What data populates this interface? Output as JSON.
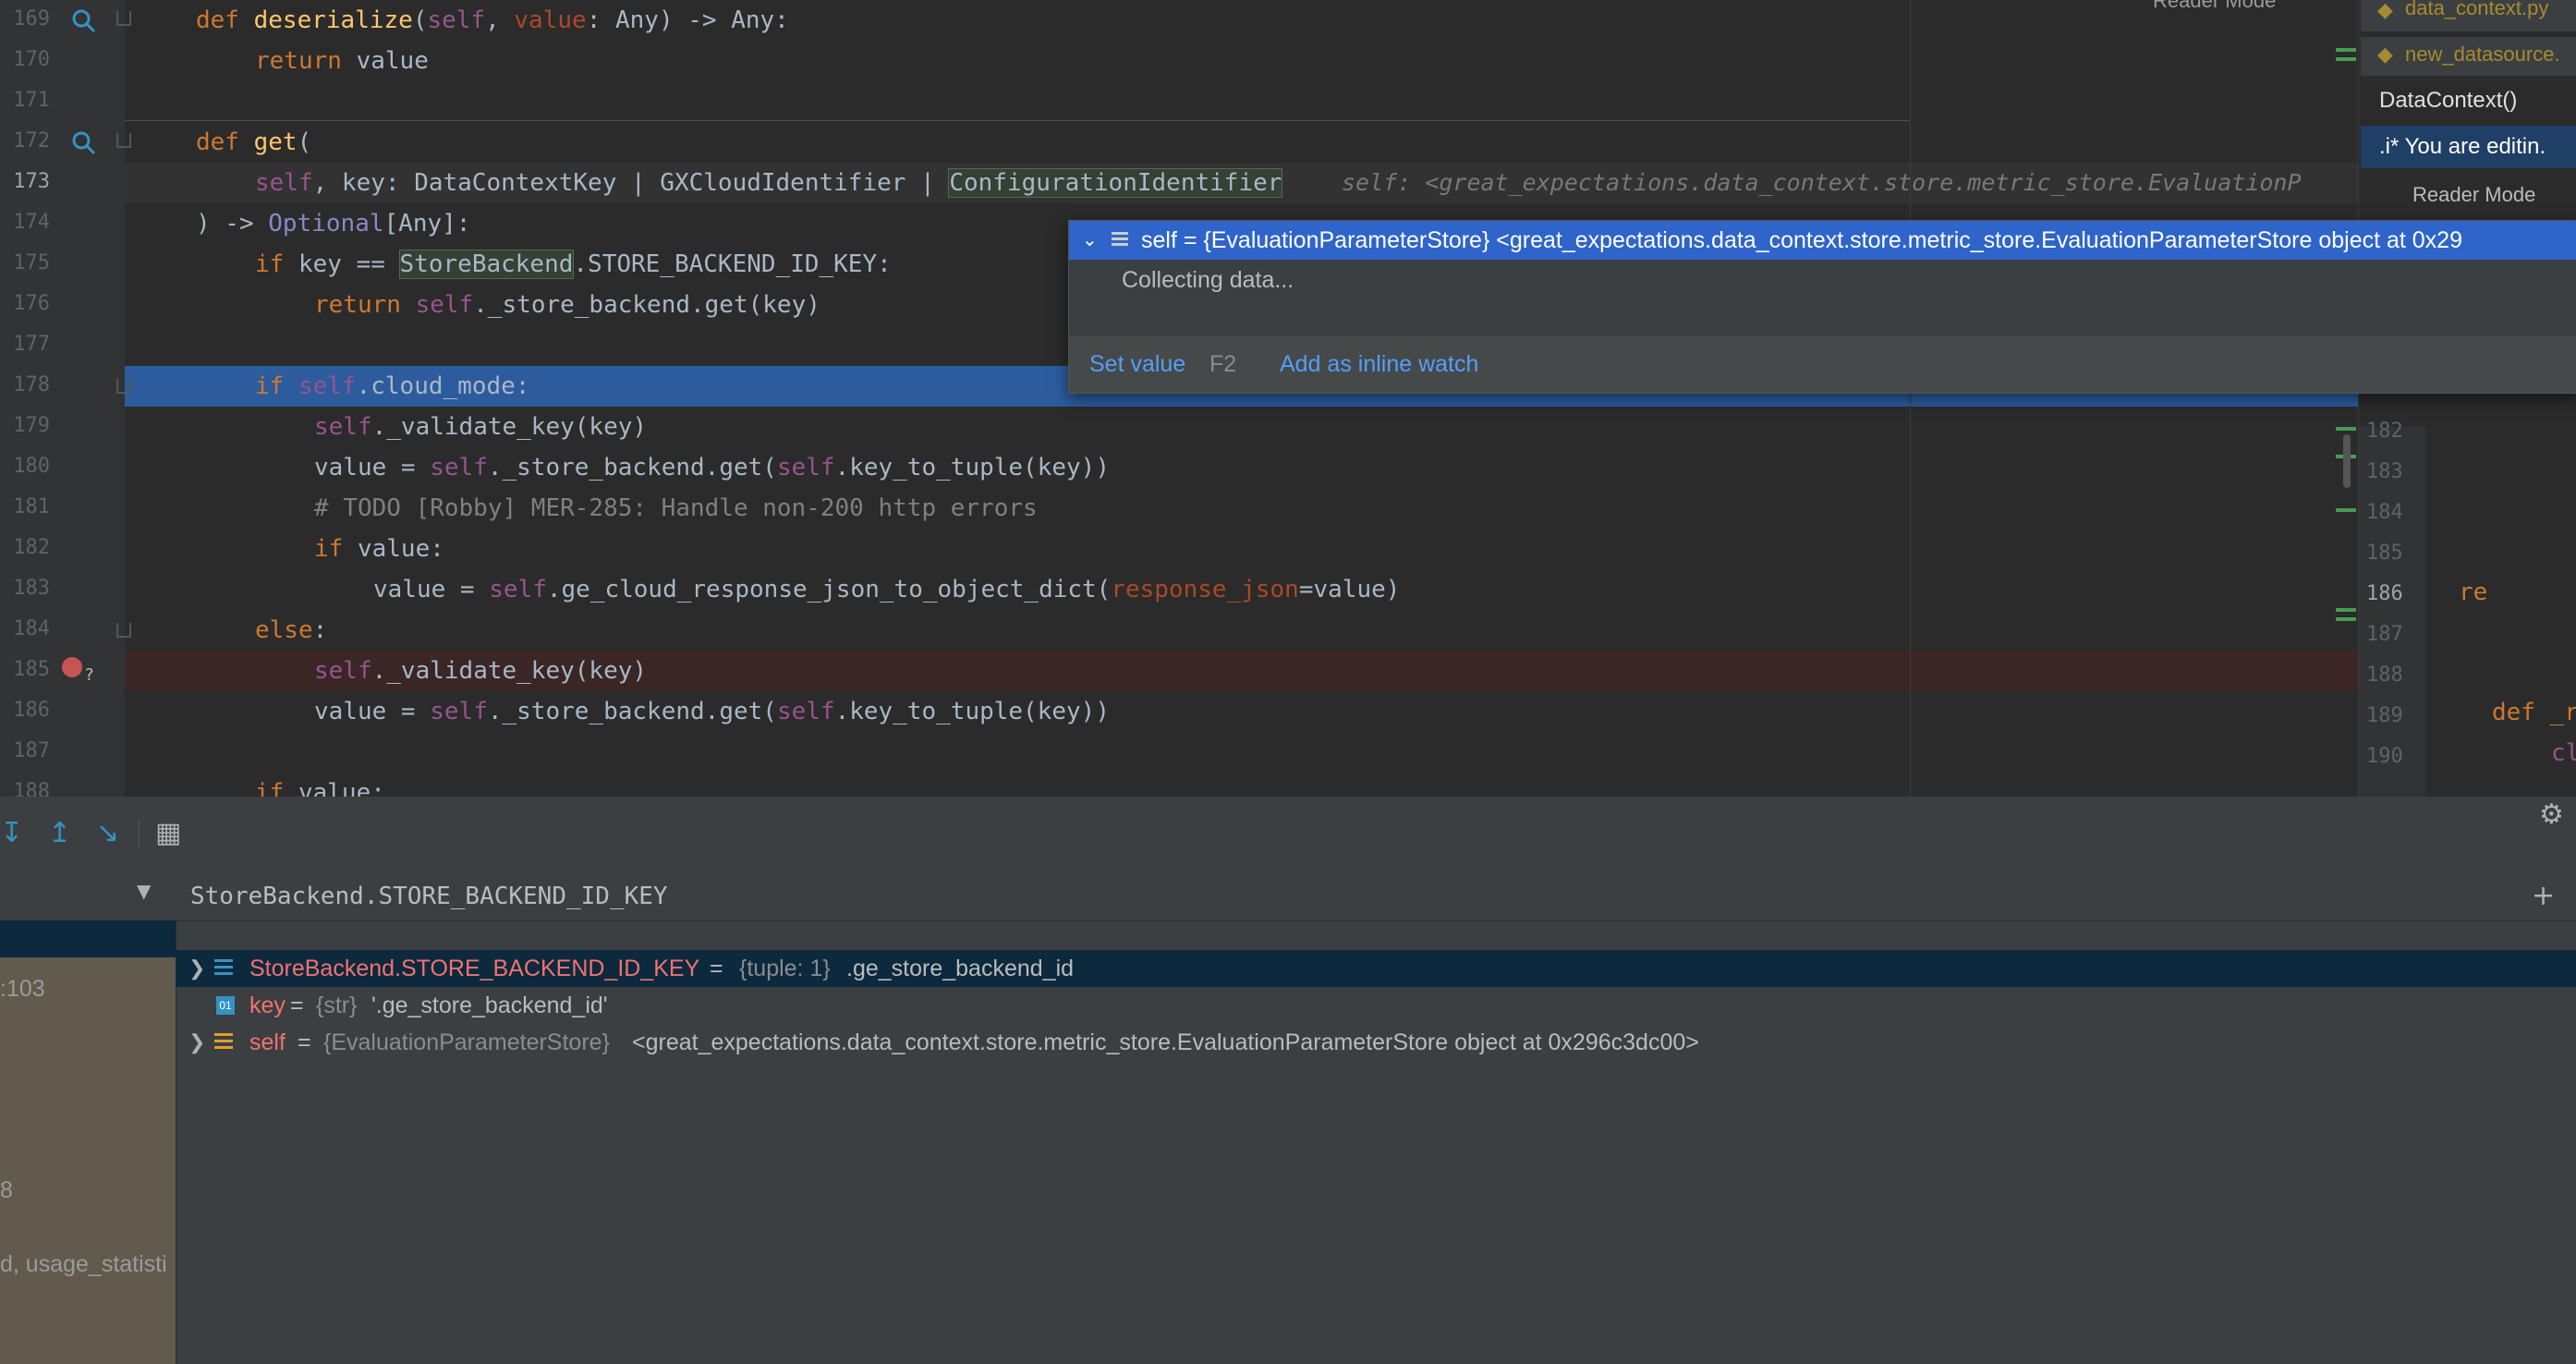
{
  "editor": {
    "lines": [
      {
        "num": "169",
        "text": "def deserialize(self, value: Any) -> Any:"
      },
      {
        "num": "170",
        "text": "return value"
      },
      {
        "num": "171",
        "text": ""
      },
      {
        "num": "172",
        "text": "def get("
      },
      {
        "num": "173",
        "text": "self, key: DataContextKey | GXCloudIdentifier | ConfigurationIdentifier"
      },
      {
        "num": "174",
        "text": ") -> Optional[Any]:"
      },
      {
        "num": "175",
        "text": "if key == StoreBackend.STORE_BACKEND_ID_KEY:"
      },
      {
        "num": "176",
        "text": "return self._store_backend.get(key)"
      },
      {
        "num": "177",
        "text": ""
      },
      {
        "num": "178",
        "text": "if self.cloud_mode:"
      },
      {
        "num": "179",
        "text": "self._validate_key(key)"
      },
      {
        "num": "180",
        "text": "value = self._store_backend.get(self.key_to_tuple(key))"
      },
      {
        "num": "181",
        "text": "# TODO [Robby] MER-285: Handle non-200 http errors"
      },
      {
        "num": "182",
        "text": "if value:"
      },
      {
        "num": "183",
        "text": "value = self.ge_cloud_response_json_to_object_dict(response_json=value)"
      },
      {
        "num": "184",
        "text": "else:"
      },
      {
        "num": "185",
        "text": "self._validate_key(key)"
      },
      {
        "num": "186",
        "text": "value = self._store_backend.get(self.key_to_tuple(key))"
      },
      {
        "num": "187",
        "text": ""
      },
      {
        "num": "188",
        "text": "if value:"
      }
    ],
    "inline_hint": "self: <great_expectations.data_context.store.metric_store.EvaluationP"
  },
  "popup": {
    "header": "self = {EvaluationParameterStore} <great_expectations.data_context.store.metric_store.EvaluationParameterStore object at 0x29",
    "status": "Collecting data...",
    "set_value": "Set value",
    "set_value_shortcut": "F2",
    "add_watch": "Add as inline watch"
  },
  "right_panel": {
    "tabs": [
      "data_context.py",
      "new_datasource."
    ],
    "reader_mode_top": "Reader Mode",
    "reader_mode": "Reader Mode",
    "lines": [
      "DataContext()",
      ".i* You are editin."
    ],
    "line_numbers": [
      "182",
      "183",
      "184",
      "185",
      "186",
      "187",
      "188",
      "189",
      "190"
    ],
    "fragments": [
      "re",
      "def _r",
      "cl"
    ]
  },
  "debug": {
    "watch_expression": "StoreBackend.STORE_BACKEND_ID_KEY",
    "frame_fragments": [
      ":103",
      "8",
      "d, usage_statisti"
    ],
    "variables": [
      {
        "name": "StoreBackend.STORE_BACKEND_ID_KEY",
        "type": "{tuple: 1}",
        "value": ".ge_store_backend_id",
        "expandable": true
      },
      {
        "name": "key",
        "type": "{str}",
        "value": "'.ge_store_backend_id'",
        "expandable": false
      },
      {
        "name": "self",
        "type": "{EvaluationParameterStore}",
        "value": "<great_expectations.data_context.store.metric_store.EvaluationParameterStore object at 0x296c3dc00>",
        "expandable": true
      }
    ]
  }
}
